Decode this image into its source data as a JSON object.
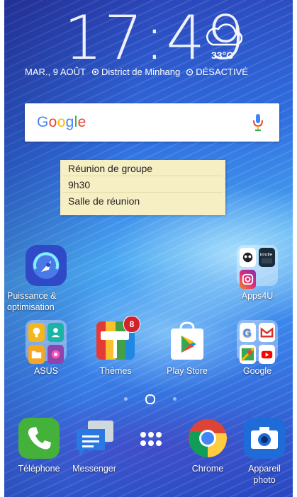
{
  "status": {
    "time": "17:49",
    "temperature": "33°C",
    "date": "MAR., 9 AOÛT",
    "location": "District de Minhang",
    "alarm": "DÉSACTIVÉ"
  },
  "search_widget": {
    "logo": "Google"
  },
  "note_widget": {
    "lines": [
      "Réunion de groupe",
      "9h30",
      "Salle de réunion"
    ]
  },
  "apps": {
    "puissance": "Puissance & optimisation",
    "apps4u": "Apps4U",
    "asus": "ASUS",
    "themes": "Thèmes",
    "themes_badge": "8",
    "playstore": "Play Store",
    "google": "Google"
  },
  "page_indicator": {
    "pages": 3,
    "current": 2
  },
  "dock": {
    "telephone": "Téléphone",
    "messenger": "Messenger",
    "chrome": "Chrome",
    "appareil": "Appareil photo"
  },
  "colors": {
    "note_bg": "#f7efc4",
    "badge": "#d3222b",
    "phone": "#43b13a",
    "messenger": "#2a78e4",
    "themes_red": "#e53935"
  }
}
